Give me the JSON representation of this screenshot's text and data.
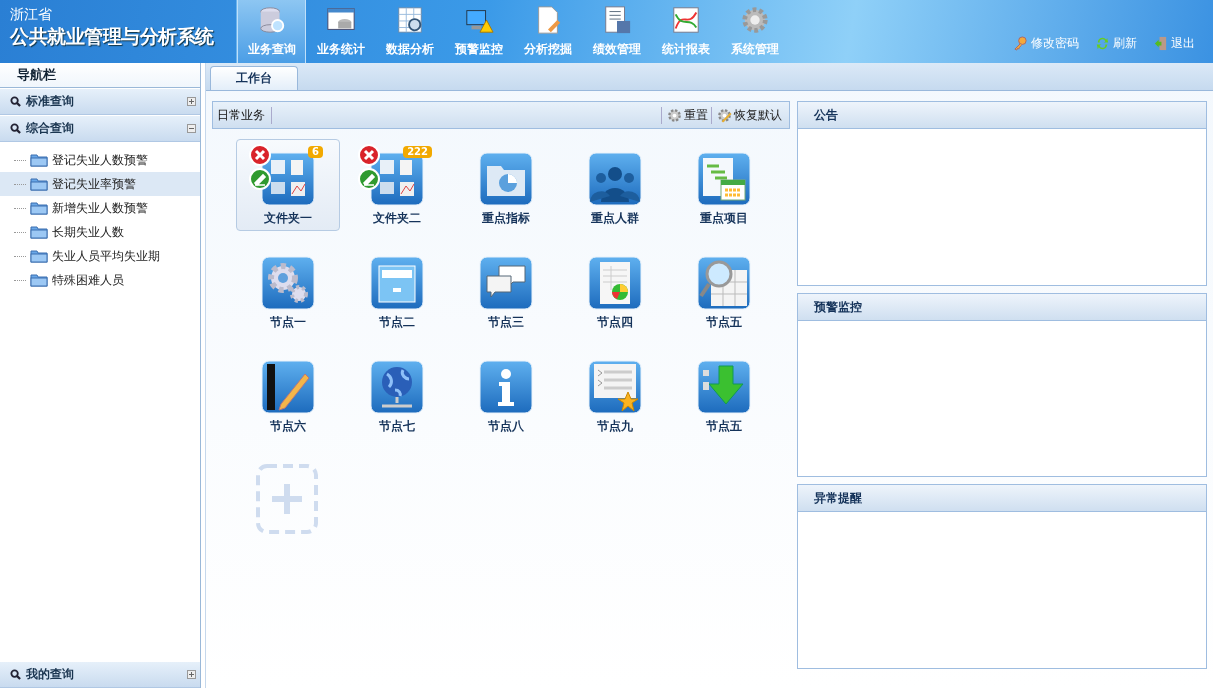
{
  "header": {
    "province": "浙江省",
    "system_title": "公共就业管理与分析系统",
    "nav": [
      {
        "label": "业务查询",
        "selected": true
      },
      {
        "label": "业务统计",
        "selected": false
      },
      {
        "label": "数据分析",
        "selected": false
      },
      {
        "label": "预警监控",
        "selected": false
      },
      {
        "label": "分析挖掘",
        "selected": false
      },
      {
        "label": "绩效管理",
        "selected": false
      },
      {
        "label": "统计报表",
        "selected": false
      },
      {
        "label": "系统管理",
        "selected": false
      }
    ],
    "links": [
      "修改密码",
      "刷新",
      "退出"
    ]
  },
  "sidebar": {
    "title": "导航栏",
    "sections": [
      {
        "label": "标准查询",
        "expanded": false
      },
      {
        "label": "综合查询",
        "expanded": true,
        "children": [
          {
            "label": "登记失业人数预警",
            "selected": false
          },
          {
            "label": "登记失业率预警",
            "selected": true
          },
          {
            "label": "新增失业人数预警",
            "selected": false
          },
          {
            "label": "长期失业人数",
            "selected": false
          },
          {
            "label": "失业人员平均失业期",
            "selected": false
          },
          {
            "label": "特殊困难人员",
            "selected": false
          }
        ]
      },
      {
        "label": "我的查询",
        "expanded": false
      }
    ]
  },
  "tabs": [
    {
      "label": "工作台",
      "selected": true
    }
  ],
  "workspace": {
    "title": "日常业务",
    "actions": [
      "重置",
      "恢复默认"
    ],
    "tiles": [
      {
        "kind": "folder",
        "label": "文件夹一",
        "badge": "6",
        "selected": true
      },
      {
        "kind": "folder",
        "label": "文件夹二",
        "badge": "222",
        "selected": false
      },
      {
        "kind": "app",
        "label": "重点指标",
        "selected": false
      },
      {
        "kind": "app",
        "label": "重点人群",
        "selected": false
      },
      {
        "kind": "app",
        "label": "重点项目",
        "selected": false
      },
      {
        "kind": "app",
        "label": "节点一",
        "selected": false
      },
      {
        "kind": "app",
        "label": "节点二",
        "selected": false
      },
      {
        "kind": "app",
        "label": "节点三",
        "selected": false
      },
      {
        "kind": "app",
        "label": "节点四",
        "selected": false
      },
      {
        "kind": "app",
        "label": "节点五",
        "selected": false
      },
      {
        "kind": "app",
        "label": "节点六",
        "selected": false
      },
      {
        "kind": "app",
        "label": "节点七",
        "selected": false
      },
      {
        "kind": "app",
        "label": "节点八",
        "selected": false
      },
      {
        "kind": "app",
        "label": "节点九",
        "selected": false
      },
      {
        "kind": "app",
        "label": "节点五",
        "selected": false
      },
      {
        "kind": "add"
      }
    ]
  },
  "panels": [
    {
      "title": "公告"
    },
    {
      "title": "预警监控"
    },
    {
      "title": "异常提醒"
    }
  ]
}
